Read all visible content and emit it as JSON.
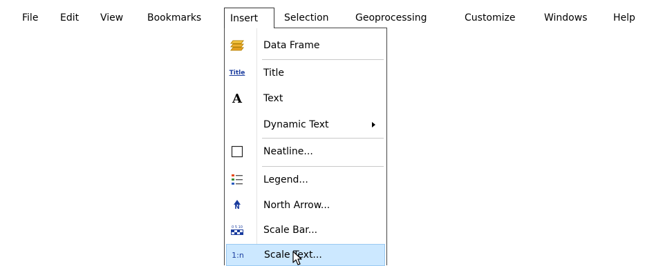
{
  "menubar": {
    "items": [
      "File",
      "Edit",
      "View",
      "Bookmarks",
      "Insert",
      "Selection",
      "Geoprocessing",
      "Customize",
      "Windows",
      "Help"
    ],
    "open_item": "Insert"
  },
  "insert_menu": {
    "items": [
      {
        "label": "Data Frame",
        "icon": "data-frame-icon"
      },
      {
        "label": "Title",
        "icon": "title-icon",
        "icon_text": "Title"
      },
      {
        "label": "Text",
        "icon": "text-icon",
        "icon_text": "A"
      },
      {
        "label": "Dynamic Text",
        "icon": "none",
        "submenu": true
      },
      {
        "label": "Neatline...",
        "icon": "neatline-icon"
      },
      {
        "label": "Legend...",
        "icon": "legend-icon"
      },
      {
        "label": "North Arrow...",
        "icon": "north-arrow-icon",
        "icon_text": "N"
      },
      {
        "label": "Scale Bar...",
        "icon": "scale-bar-icon",
        "icon_text": "0 5 10"
      },
      {
        "label": "Scale Text...",
        "icon": "scale-text-icon",
        "icon_text": "1:n",
        "highlighted": true
      }
    ]
  },
  "colors": {
    "highlight": "#cce8ff",
    "highlight_border": "#99c9f2",
    "menu_border": "#444444"
  }
}
